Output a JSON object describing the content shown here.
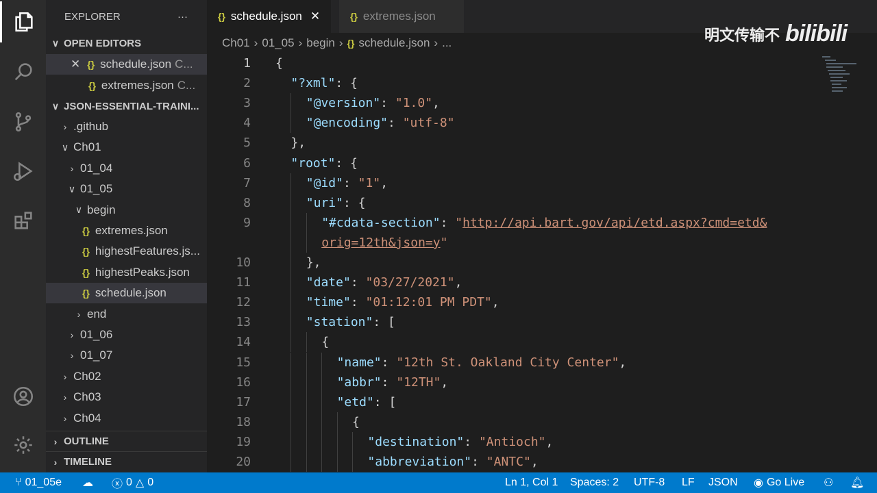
{
  "sidebar": {
    "title": "EXPLORER",
    "more": "···",
    "open_editors": "OPEN EDITORS",
    "open_files": [
      {
        "name": "schedule.json",
        "hint": "C..."
      },
      {
        "name": "extremes.json",
        "hint": "C..."
      }
    ],
    "project": "JSON-ESSENTIAL-TRAINI...",
    "tree": [
      {
        "label": ".github",
        "depth": 1,
        "type": "folder",
        "open": false
      },
      {
        "label": "Ch01",
        "depth": 1,
        "type": "folder",
        "open": true
      },
      {
        "label": "01_04",
        "depth": 2,
        "type": "folder",
        "open": false
      },
      {
        "label": "01_05",
        "depth": 2,
        "type": "folder",
        "open": true
      },
      {
        "label": "begin",
        "depth": 3,
        "type": "folder",
        "open": true
      },
      {
        "label": "extremes.json",
        "depth": 4,
        "type": "file"
      },
      {
        "label": "highestFeatures.js...",
        "depth": 4,
        "type": "file"
      },
      {
        "label": "highestPeaks.json",
        "depth": 4,
        "type": "file"
      },
      {
        "label": "schedule.json",
        "depth": 4,
        "type": "file",
        "selected": true
      },
      {
        "label": "end",
        "depth": 3,
        "type": "folder",
        "open": false
      },
      {
        "label": "01_06",
        "depth": 2,
        "type": "folder",
        "open": false
      },
      {
        "label": "01_07",
        "depth": 2,
        "type": "folder",
        "open": false
      },
      {
        "label": "Ch02",
        "depth": 1,
        "type": "folder",
        "open": false
      },
      {
        "label": "Ch03",
        "depth": 1,
        "type": "folder",
        "open": false
      },
      {
        "label": "Ch04",
        "depth": 1,
        "type": "folder",
        "open": false
      }
    ],
    "outline": "OUTLINE",
    "timeline": "TIMELINE"
  },
  "tabs": [
    {
      "label": "schedule.json",
      "active": true
    },
    {
      "label": "extremes.json",
      "active": false
    }
  ],
  "breadcrumb": [
    "Ch01",
    "01_05",
    "begin",
    "schedule.json",
    "..."
  ],
  "watermark": {
    "text": "明文传输不",
    "logo": "bilibili"
  },
  "code": [
    {
      "n": "1",
      "i": 0,
      "t": [
        [
          "p",
          "{"
        ]
      ]
    },
    {
      "n": "2",
      "i": 1,
      "t": [
        [
          "k",
          "\"?xml\""
        ],
        [
          "p",
          ": {"
        ]
      ]
    },
    {
      "n": "3",
      "i": 2,
      "t": [
        [
          "k",
          "\"@version\""
        ],
        [
          "p",
          ": "
        ],
        [
          "s",
          "\"1.0\""
        ],
        [
          "p",
          ","
        ]
      ]
    },
    {
      "n": "4",
      "i": 2,
      "t": [
        [
          "k",
          "\"@encoding\""
        ],
        [
          "p",
          ": "
        ],
        [
          "s",
          "\"utf-8\""
        ]
      ]
    },
    {
      "n": "5",
      "i": 1,
      "t": [
        [
          "p",
          "},"
        ]
      ]
    },
    {
      "n": "6",
      "i": 1,
      "t": [
        [
          "k",
          "\"root\""
        ],
        [
          "p",
          ": {"
        ]
      ]
    },
    {
      "n": "7",
      "i": 2,
      "t": [
        [
          "k",
          "\"@id\""
        ],
        [
          "p",
          ": "
        ],
        [
          "s",
          "\"1\""
        ],
        [
          "p",
          ","
        ]
      ]
    },
    {
      "n": "8",
      "i": 2,
      "t": [
        [
          "k",
          "\"uri\""
        ],
        [
          "p",
          ": {"
        ]
      ]
    },
    {
      "n": "9",
      "i": 3,
      "t": [
        [
          "k",
          "\"#cdata-section\""
        ],
        [
          "p",
          ": "
        ],
        [
          "s",
          "\""
        ],
        [
          "u",
          "http://api.bart.gov/api/etd.aspx?cmd=etd&"
        ]
      ]
    },
    {
      "n": "",
      "i": 3,
      "t": [
        [
          "u",
          "orig=12th&json=y"
        ],
        [
          "s",
          "\""
        ]
      ]
    },
    {
      "n": "10",
      "i": 2,
      "t": [
        [
          "p",
          "},"
        ]
      ]
    },
    {
      "n": "11",
      "i": 2,
      "t": [
        [
          "k",
          "\"date\""
        ],
        [
          "p",
          ": "
        ],
        [
          "s",
          "\"03/27/2021\""
        ],
        [
          "p",
          ","
        ]
      ]
    },
    {
      "n": "12",
      "i": 2,
      "t": [
        [
          "k",
          "\"time\""
        ],
        [
          "p",
          ": "
        ],
        [
          "s",
          "\"01:12:01 PM PDT\""
        ],
        [
          "p",
          ","
        ]
      ]
    },
    {
      "n": "13",
      "i": 2,
      "t": [
        [
          "k",
          "\"station\""
        ],
        [
          "p",
          ": ["
        ]
      ]
    },
    {
      "n": "14",
      "i": 3,
      "t": [
        [
          "p",
          "{"
        ]
      ]
    },
    {
      "n": "15",
      "i": 4,
      "t": [
        [
          "k",
          "\"name\""
        ],
        [
          "p",
          ": "
        ],
        [
          "s",
          "\"12th St. Oakland City Center\""
        ],
        [
          "p",
          ","
        ]
      ]
    },
    {
      "n": "16",
      "i": 4,
      "t": [
        [
          "k",
          "\"abbr\""
        ],
        [
          "p",
          ": "
        ],
        [
          "s",
          "\"12TH\""
        ],
        [
          "p",
          ","
        ]
      ]
    },
    {
      "n": "17",
      "i": 4,
      "t": [
        [
          "k",
          "\"etd\""
        ],
        [
          "p",
          ": ["
        ]
      ]
    },
    {
      "n": "18",
      "i": 5,
      "t": [
        [
          "p",
          "{"
        ]
      ]
    },
    {
      "n": "19",
      "i": 6,
      "t": [
        [
          "k",
          "\"destination\""
        ],
        [
          "p",
          ": "
        ],
        [
          "s",
          "\"Antioch\""
        ],
        [
          "p",
          ","
        ]
      ]
    },
    {
      "n": "20",
      "i": 6,
      "t": [
        [
          "k",
          "\"abbreviation\""
        ],
        [
          "p",
          ": "
        ],
        [
          "s",
          "\"ANTC\""
        ],
        [
          "p",
          ","
        ]
      ]
    }
  ],
  "status": {
    "branch": "01_05e",
    "errors": "0",
    "warnings": "0",
    "position": "Ln 1, Col 1",
    "spaces": "Spaces: 2",
    "encoding": "UTF-8",
    "eol": "LF",
    "language": "JSON",
    "golive": "Go Live"
  }
}
